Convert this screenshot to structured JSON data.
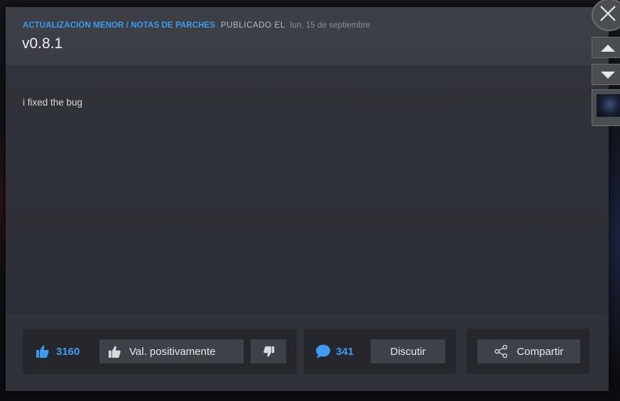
{
  "post": {
    "category": "ACTUALIZACIÓN MENOR / NOTAS DE PARCHES",
    "published_label": "PUBLICADO EL",
    "published_date": "lun, 15 de septiembre",
    "title": "v0.8.1",
    "body": "i fixed the bug"
  },
  "rating": {
    "count": "3160",
    "thumbs_up_label": "Val. positivamente"
  },
  "discussion": {
    "count": "341",
    "discuss_label": "Discutir"
  },
  "share": {
    "label": "Compartir"
  },
  "colors": {
    "accent": "#3d9cf0",
    "panel": "#25272c",
    "button": "#3d4249"
  }
}
